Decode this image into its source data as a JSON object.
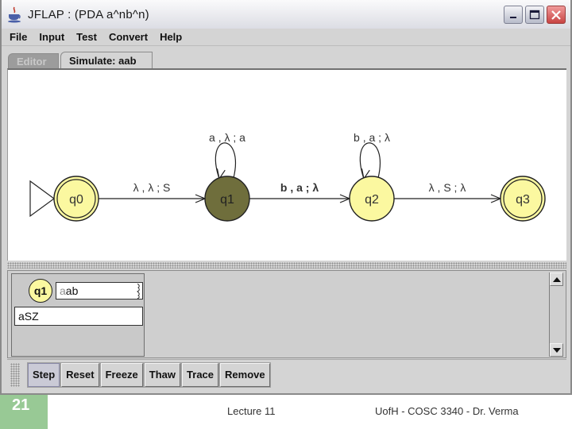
{
  "window": {
    "title": "JFLAP : (PDA a^nb^n)",
    "controls": [
      "minimize",
      "maximize",
      "close"
    ]
  },
  "menubar": {
    "items": [
      "File",
      "Input",
      "Test",
      "Convert",
      "Help"
    ]
  },
  "tabs": [
    {
      "label": "Editor",
      "active": false
    },
    {
      "label": "Simulate: aab",
      "active": true
    }
  ],
  "automaton": {
    "states": [
      {
        "id": "q0",
        "label": "q0",
        "initial": true,
        "final": true,
        "highlighted": false
      },
      {
        "id": "q1",
        "label": "q1",
        "initial": false,
        "final": false,
        "highlighted": true
      },
      {
        "id": "q2",
        "label": "q2",
        "initial": false,
        "final": false,
        "highlighted": false
      },
      {
        "id": "q3",
        "label": "q3",
        "initial": false,
        "final": true,
        "highlighted": false
      }
    ],
    "transitions": [
      {
        "from": "q0",
        "to": "q1",
        "label": "λ , λ ; S",
        "bold": false
      },
      {
        "from": "q1",
        "to": "q1",
        "label": "a , λ ; a",
        "bold": false
      },
      {
        "from": "q1",
        "to": "q2",
        "label": "b , a ; λ",
        "bold": true
      },
      {
        "from": "q2",
        "to": "q2",
        "label": "b , a ; λ",
        "bold": false
      },
      {
        "from": "q2",
        "to": "q3",
        "label": "λ , S ; λ",
        "bold": false
      }
    ],
    "colors": {
      "state_fill": "#fbf8a0",
      "highlight_fill": "#6f6e3c",
      "stroke": "#222222"
    }
  },
  "simulation": {
    "configuration": {
      "state": "q1",
      "input_consumed": "a",
      "input_remaining": "ab",
      "stack": "aSZ"
    }
  },
  "toolbar": {
    "buttons": [
      "Step",
      "Reset",
      "Freeze",
      "Thaw",
      "Trace",
      "Remove"
    ]
  },
  "slide": {
    "number": "21",
    "center_text": "Lecture 11",
    "right_text": "UofH - COSC 3340 - Dr. Verma",
    "accent_color": "#98c995"
  }
}
